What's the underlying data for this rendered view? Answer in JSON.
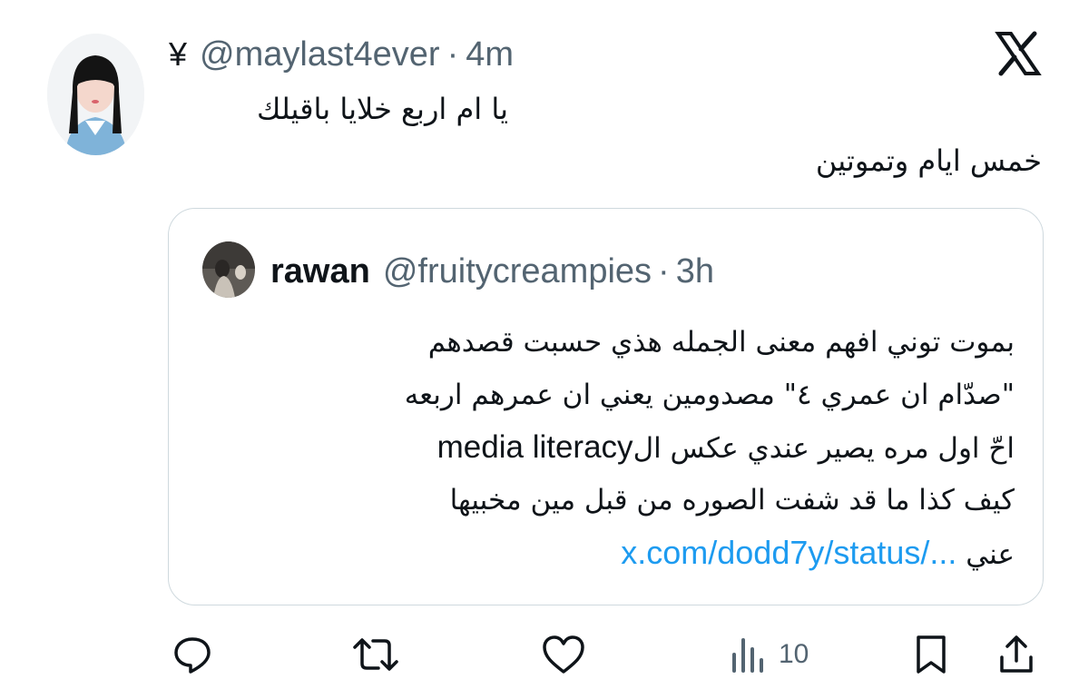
{
  "tweet": {
    "user_badge": "¥",
    "handle": "@maylast4ever",
    "separator": "·",
    "time": "4m",
    "text_line1": "يا ام اربع خلايا باقيلك",
    "text_line2": "خمس ايام وتموتين"
  },
  "quote": {
    "name": "rawan",
    "handle": "@fruitycreampies",
    "separator": "·",
    "time": "3h",
    "lines": [
      "بموت توني افهم معنى الجمله هذي حسبت قصدهم",
      "\"صدّام ان عمري ٤\" مصدومين يعني ان عمرهم اربعه",
      "كيف كذا ما قد شفت الصوره من قبل مين مخبيها"
    ],
    "line3_arabic": "احّ اول مره يصير عندي عكس ال",
    "line3_english": "media literacy",
    "last_line_arabic": "عني",
    "link_text": "x.com/dodd7y/status/..."
  },
  "actions": {
    "views_count": "10"
  },
  "colors": {
    "text_primary": "#0f1419",
    "text_secondary": "#536471",
    "link": "#1d9bf0",
    "border": "#cfd9de"
  },
  "icons": [
    "x-logo-icon",
    "reply-icon",
    "retweet-icon",
    "like-icon",
    "views-icon",
    "bookmark-icon",
    "share-icon"
  ]
}
